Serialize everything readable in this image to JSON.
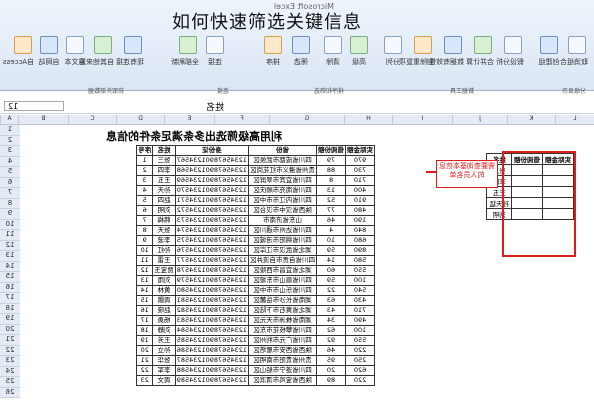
{
  "headline": "如何快速筛选关键信息",
  "window_title": "Microsoft Excel",
  "ribbon": {
    "buttons": [
      "自Access",
      "自网站",
      "自文本",
      "自其他来源",
      "现有连接",
      "全部刷新",
      "连接",
      "属性",
      "编辑链接",
      "排序",
      "筛选",
      "清除",
      "重新应用",
      "高级",
      "分列",
      "删除重复项",
      "数据有效性",
      "合并计算",
      "假设分析",
      "创建组",
      "取消组合",
      "分类汇总"
    ],
    "groups": [
      "获取外部数据",
      "连接",
      "排序和筛选",
      "数据工具",
      "分级显示"
    ]
  },
  "formula_bar": {
    "name_box": "12",
    "formula": "姓名"
  },
  "columns": [
    "A",
    "B",
    "C",
    "D",
    "E",
    "F",
    "G",
    "H",
    "I",
    "J",
    "K",
    "L"
  ],
  "main_table": {
    "title": "利用高级筛选出多条满足条件的信息",
    "headers": [
      "序号",
      "姓名",
      "身份证",
      "省份",
      "借阅份额",
      "实际金额"
    ],
    "rows": [
      [
        "1",
        "张三",
        "12345678901234567",
        "四川省成都市武侯区",
        "79",
        "970"
      ],
      [
        "2",
        "李四",
        "12345678901234568",
        "贵州省遵义市红花岗区",
        "88",
        "730"
      ],
      [
        "3",
        "王五",
        "12345678901234569",
        "四川省宜宾市翠屏区",
        "8",
        "710"
      ],
      [
        "4",
        "孙天",
        "12345678901234570",
        "四川省南充市顺庆区",
        "13",
        "400"
      ],
      [
        "5",
        "赵四",
        "12345678901234571",
        "四川省内江市市中区",
        "52",
        "910"
      ],
      [
        "6",
        "刘明",
        "12345678901234572",
        "陕西省汉中市汉台区",
        "77",
        "480"
      ],
      [
        "7",
        "韩梅",
        "12345678901234573",
        "山东省济南市",
        "46",
        "190"
      ],
      [
        "8",
        "张天",
        "12345678901234574",
        "四川省达州市通川区",
        "4",
        "840"
      ],
      [
        "9",
        "李波",
        "12345678901234575",
        "四川省绵阳市涪城区",
        "10",
        "680"
      ],
      [
        "10",
        "孙红",
        "12345678901234576",
        "湖北省武汉市江岸区",
        "59",
        "890"
      ],
      [
        "11",
        "王雷",
        "12345678901234577",
        "四川省自贡市自流井区",
        "14",
        "580"
      ],
      [
        "12",
        "贾宝玉",
        "12345678901234578",
        "湖北省宜昌市西陵区",
        "60",
        "550"
      ],
      [
        "13",
        "刘雨",
        "12345678901234579",
        "四川省眉山市东坡区",
        "59",
        "100"
      ],
      [
        "14",
        "黄林",
        "12345678901234580",
        "四川省乐山市市中区",
        "22",
        "540"
      ],
      [
        "15",
        "周鹏",
        "12345678901234581",
        "湖南省长沙市岳麓区",
        "63",
        "430"
      ],
      [
        "16",
        "赵晓",
        "12345678901234582",
        "湖北省黄石市下陆区",
        "43",
        "710"
      ],
      [
        "17",
        "杨勇",
        "12345678901234583",
        "湖南省株洲市天元区",
        "34",
        "490"
      ],
      [
        "18",
        "刘静",
        "12345678901234584",
        "四川省攀枝花市东区",
        "62",
        "100"
      ],
      [
        "19",
        "王芳",
        "12345678901234585",
        "四川省广元市利州区",
        "92",
        "550"
      ],
      [
        "20",
        "孙立",
        "12345678901234586",
        "陕西省西安市雁塔区",
        "46",
        "220"
      ],
      [
        "21",
        "张华",
        "12345678901234587",
        "贵州省贵阳市南明区",
        "95",
        "250"
      ],
      [
        "22",
        "李军",
        "12345678901234588",
        "四川省遂宁市船山区",
        "20",
        "620"
      ],
      [
        "23",
        "周文",
        "12345678901234589",
        "陕西省宝鸡市渭滨区",
        "89",
        "220"
      ]
    ]
  },
  "criteria_table": {
    "headers": [
      "姓名",
      "借阅份额",
      "实际金额"
    ],
    "rows": [
      [
        "张三",
        "",
        ""
      ],
      [
        "李四",
        "",
        ""
      ],
      [
        "王五",
        "",
        ""
      ],
      [
        "孙天猛",
        "",
        ""
      ],
      [
        "刘明",
        "",
        ""
      ]
    ]
  },
  "note": "需要查询基本信息的人员名单"
}
